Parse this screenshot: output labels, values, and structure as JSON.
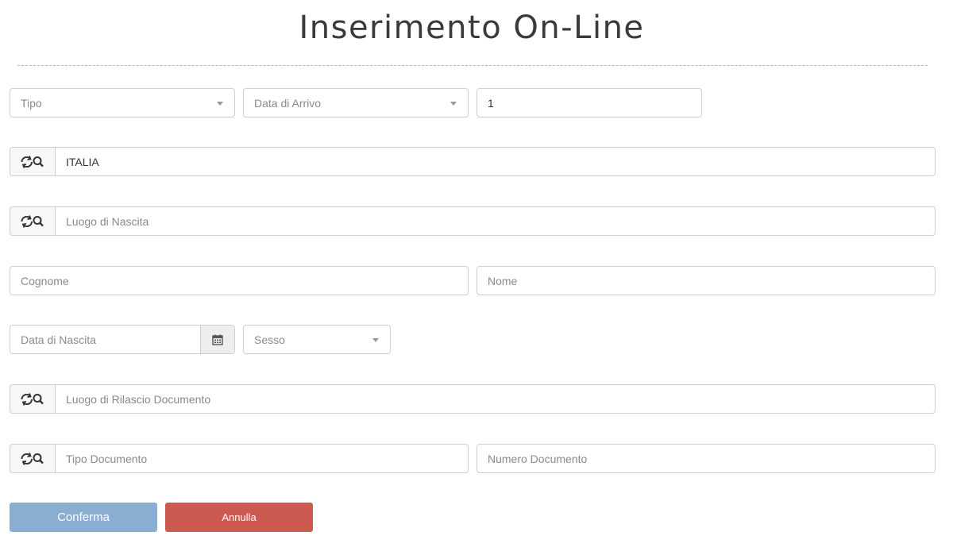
{
  "page": {
    "title": "Inserimento On-Line"
  },
  "form": {
    "tipo": {
      "placeholder": "Tipo"
    },
    "data_arrivo": {
      "placeholder": "Data di Arrivo"
    },
    "quantita": {
      "value": "1"
    },
    "nazione": {
      "value": "ITALIA"
    },
    "luogo_nascita": {
      "placeholder": "Luogo di Nascita"
    },
    "cognome": {
      "placeholder": "Cognome"
    },
    "nome": {
      "placeholder": "Nome"
    },
    "data_nascita": {
      "placeholder": "Data di Nascita"
    },
    "sesso": {
      "placeholder": "Sesso"
    },
    "luogo_rilascio": {
      "placeholder": "Luogo di Rilascio Documento"
    },
    "tipo_documento": {
      "placeholder": "Tipo Documento"
    },
    "numero_documento": {
      "placeholder": "Numero Documento"
    }
  },
  "buttons": {
    "confirm": "Conferma",
    "cancel": "Annulla"
  },
  "icons": {
    "lookup": "refresh-search-icon",
    "calendar": "calendar-icon",
    "dropdown": "caret-down-icon"
  },
  "colors": {
    "confirm": "#8aaed1",
    "cancel": "#cc5a50"
  }
}
